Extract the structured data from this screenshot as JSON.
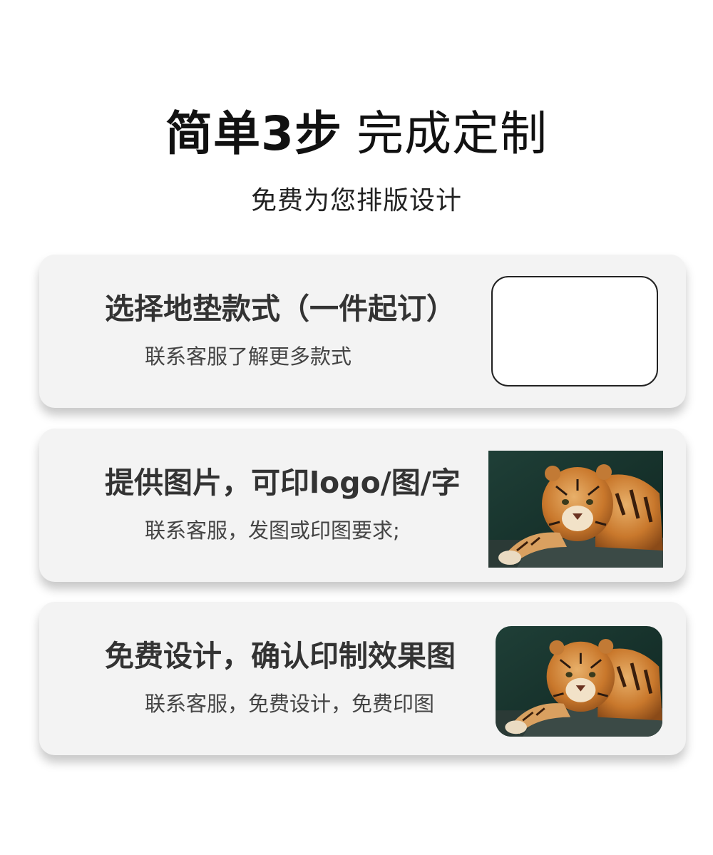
{
  "header": {
    "title_bold": "简单3步",
    "title_light": "完成定制",
    "subtitle": "免费为您排版设计"
  },
  "steps": [
    {
      "heading": "选择地垫款式（一件起订）",
      "description": "联系客服了解更多款式",
      "visual": "blank-mat-swatch"
    },
    {
      "heading": "提供图片，可印logo/图/字",
      "description": "联系客服，发图或印图要求;",
      "visual": "tiger-photo"
    },
    {
      "heading": "免费设计，确认印制效果图",
      "description": "联系客服，免费设计，免费印图",
      "visual": "tiger-photo-rounded"
    }
  ],
  "colors": {
    "card_background": "#f3f3f3",
    "title_text": "#111111",
    "heading_text": "#333333",
    "photo_background": "#1d3a34",
    "tiger_orange": "#c9782c"
  }
}
